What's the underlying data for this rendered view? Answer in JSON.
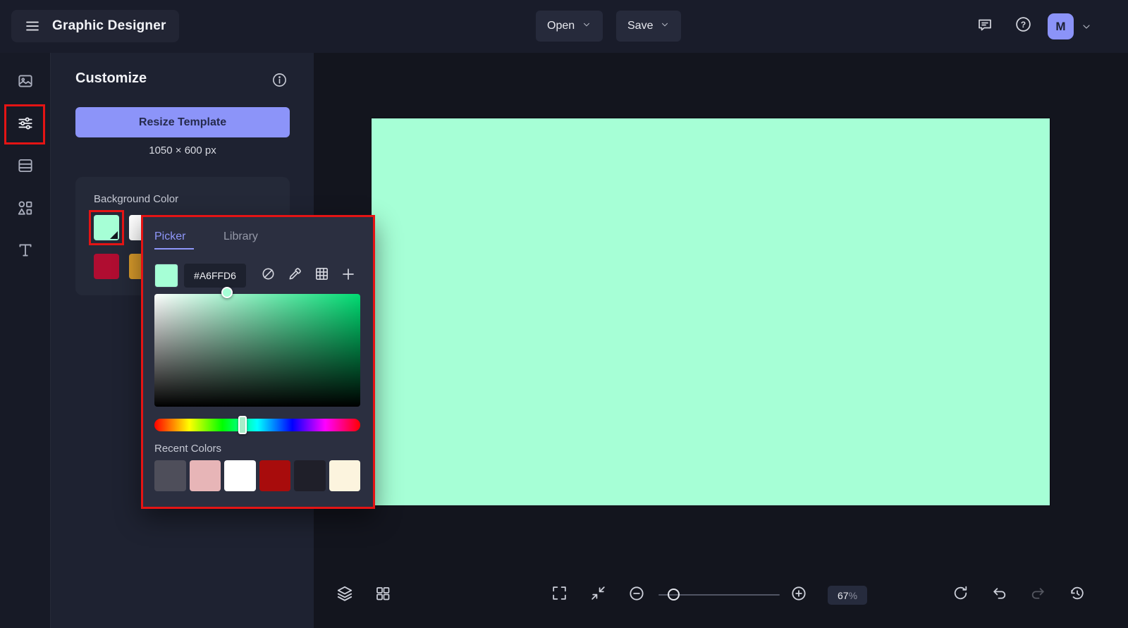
{
  "topbar": {
    "title": "Graphic Designer",
    "open_label": "Open",
    "save_label": "Save",
    "avatar_initial": "M"
  },
  "sidebar": {
    "items": [
      {
        "icon": "image-icon"
      },
      {
        "icon": "adjust-sliders-icon"
      },
      {
        "icon": "pages-icon"
      },
      {
        "icon": "shapes-icon"
      },
      {
        "icon": "text-icon"
      }
    ]
  },
  "panel": {
    "title": "Customize",
    "resize_label": "Resize Template",
    "size_text": "1050 × 600 px",
    "background_color_label": "Background Color",
    "swatches": {
      "mint": "#A6FFD6",
      "white": "#FFFFFF",
      "crimson": "#B00D31",
      "gold": "#D79A2B"
    }
  },
  "picker": {
    "tab_picker": "Picker",
    "tab_library": "Library",
    "hex": "#A6FFD6",
    "recent_label": "Recent Colors",
    "recent": {
      "c0": "#4E4E5A",
      "c1": "#E7B5B7",
      "c2": "#FFFFFF",
      "c3": "#A80C0C",
      "c4": "#1F1F29",
      "c5": "#FCF4DE"
    }
  },
  "canvas": {
    "color": "#A6FFD6"
  },
  "bottombar": {
    "zoom_value": "67",
    "zoom_unit": "%"
  },
  "colors": {
    "accent": "#8C94F9",
    "annotation": "#E41414",
    "mint": "#A6FFD6"
  }
}
